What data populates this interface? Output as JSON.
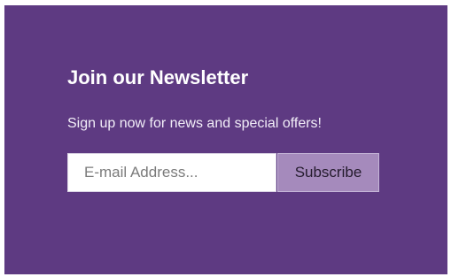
{
  "newsletter": {
    "title": "Join our Newsletter",
    "subtitle": "Sign up now for news and special offers!",
    "email_placeholder": "E-mail Address...",
    "email_value": "",
    "subscribe_label": "Subscribe"
  },
  "colors": {
    "panel_background": "#5e3a82",
    "button_background": "#a58abc",
    "text": "#ffffff"
  }
}
